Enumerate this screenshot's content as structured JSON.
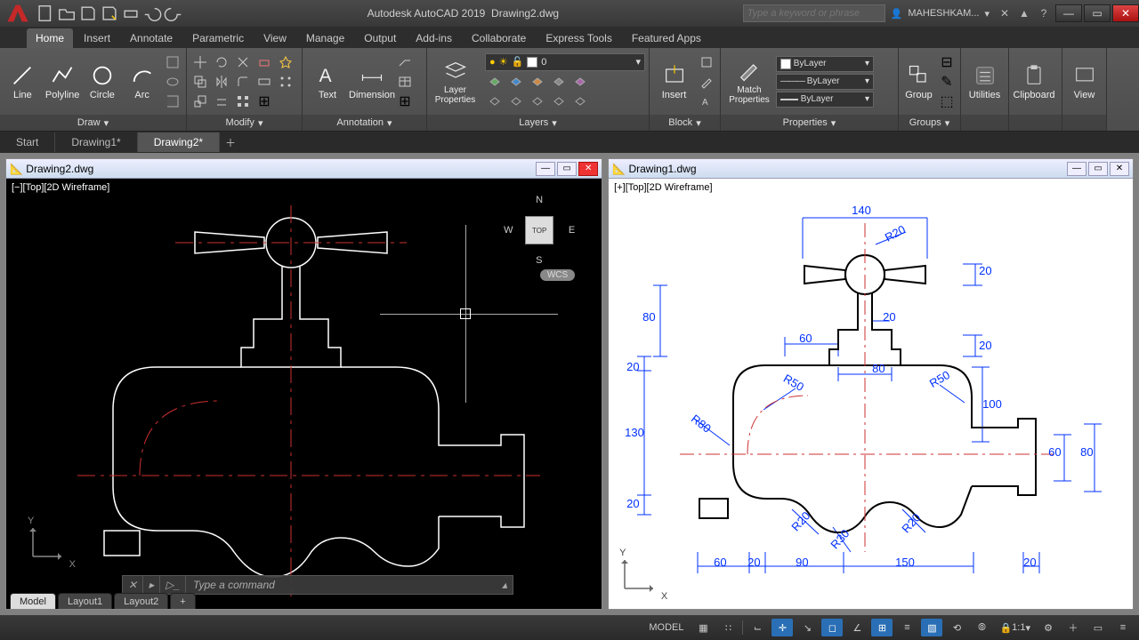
{
  "app": {
    "title": "Autodesk AutoCAD 2019",
    "document": "Drawing2.dwg",
    "search_placeholder": "Type a keyword or phrase",
    "user": "MAHESHKAM..."
  },
  "ribbon_tabs": [
    "Home",
    "Insert",
    "Annotate",
    "Parametric",
    "View",
    "Manage",
    "Output",
    "Add-ins",
    "Collaborate",
    "Express Tools",
    "Featured Apps"
  ],
  "active_ribbon_tab": "Home",
  "panels": {
    "draw": {
      "title": "Draw",
      "items": [
        "Line",
        "Polyline",
        "Circle",
        "Arc"
      ]
    },
    "modify": {
      "title": "Modify"
    },
    "annotation": {
      "title": "Annotation",
      "items": [
        "Text",
        "Dimension"
      ]
    },
    "layers": {
      "title": "Layers",
      "big": "Layer Properties",
      "current": "0"
    },
    "block": {
      "title": "Block",
      "items": [
        "Insert"
      ]
    },
    "properties": {
      "title": "Properties",
      "big": "Match Properties",
      "color": "ByLayer",
      "ltype": "ByLayer",
      "lweight": "ByLayer"
    },
    "groups": {
      "title": "Groups",
      "items": [
        "Group"
      ]
    },
    "utilities": {
      "title": "Utilities"
    },
    "clipboard": {
      "title": "Clipboard"
    },
    "view": {
      "title": "View"
    }
  },
  "doc_tabs": [
    "Start",
    "Drawing1*",
    "Drawing2*"
  ],
  "active_doc_tab": "Drawing2*",
  "windows": {
    "left": {
      "title": "Drawing2.dwg",
      "view": "[−][Top][2D Wireframe]",
      "viewcube": {
        "face": "TOP",
        "n": "N",
        "s": "S",
        "e": "E",
        "w": "W"
      },
      "wcs": "WCS"
    },
    "right": {
      "title": "Drawing1.dwg",
      "view": "[+][Top][2D Wireframe]"
    }
  },
  "dimensions": {
    "d140": "140",
    "r20": "R20",
    "d20a": "20",
    "d80a": "80",
    "d20b": "20",
    "d60": "60",
    "d20c": "20",
    "d80b": "80",
    "r50a": "R50",
    "r50b": "R50",
    "d100": "100",
    "d130": "130",
    "r80": "R80",
    "d60b": "60",
    "d80c": "80",
    "r20a": "R20",
    "r30": "R30",
    "r20b": "R20",
    "d20d": "20",
    "d60c": "60",
    "d20e": "20",
    "d90": "90",
    "d150": "150",
    "d20f": "20"
  },
  "command": {
    "placeholder": "Type a command"
  },
  "layout_tabs": [
    "Model",
    "Layout1",
    "Layout2"
  ],
  "active_layout": "Model",
  "status": {
    "model": "MODEL",
    "scale": "1:1"
  },
  "ucs": {
    "x": "X",
    "y": "Y"
  }
}
